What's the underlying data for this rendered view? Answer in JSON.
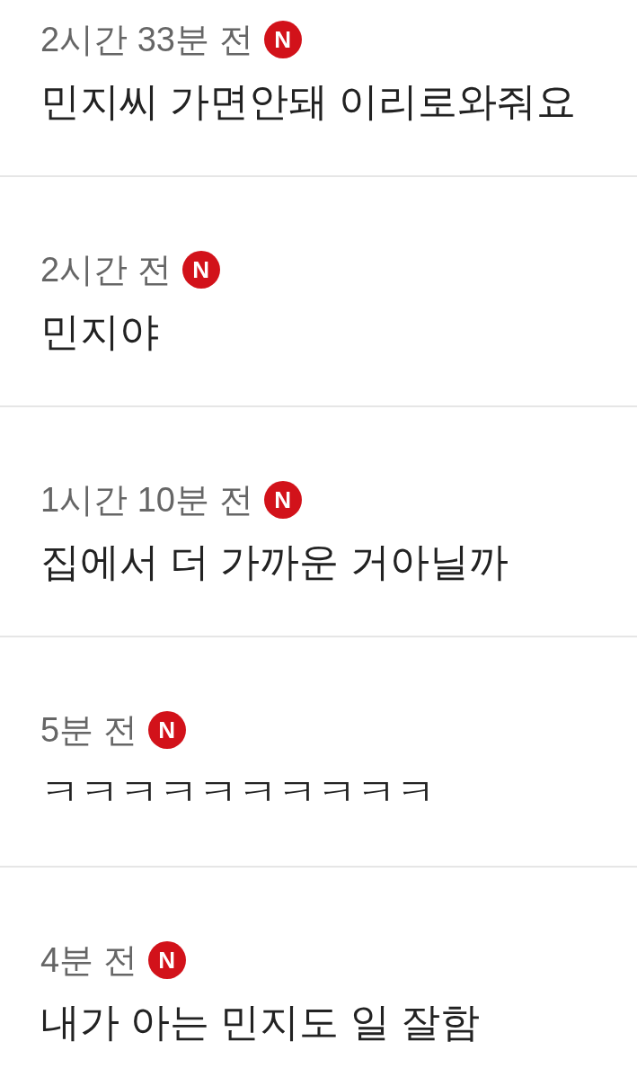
{
  "comments": [
    {
      "time": "2시간 33분 전",
      "badge": "N",
      "text": "민지씨 가면안돼 이리로와줘요"
    },
    {
      "time": "2시간 전",
      "badge": "N",
      "text": "민지야"
    },
    {
      "time": "1시간 10분 전",
      "badge": "N",
      "text": "집에서 더 가까운 거아닐까"
    },
    {
      "time": "5분 전",
      "badge": "N",
      "text": "ㅋㅋㅋㅋㅋㅋㅋㅋㅋㅋ"
    },
    {
      "time": "4분 전",
      "badge": "N",
      "text": "내가 아는 민지도 일 잘함"
    }
  ]
}
